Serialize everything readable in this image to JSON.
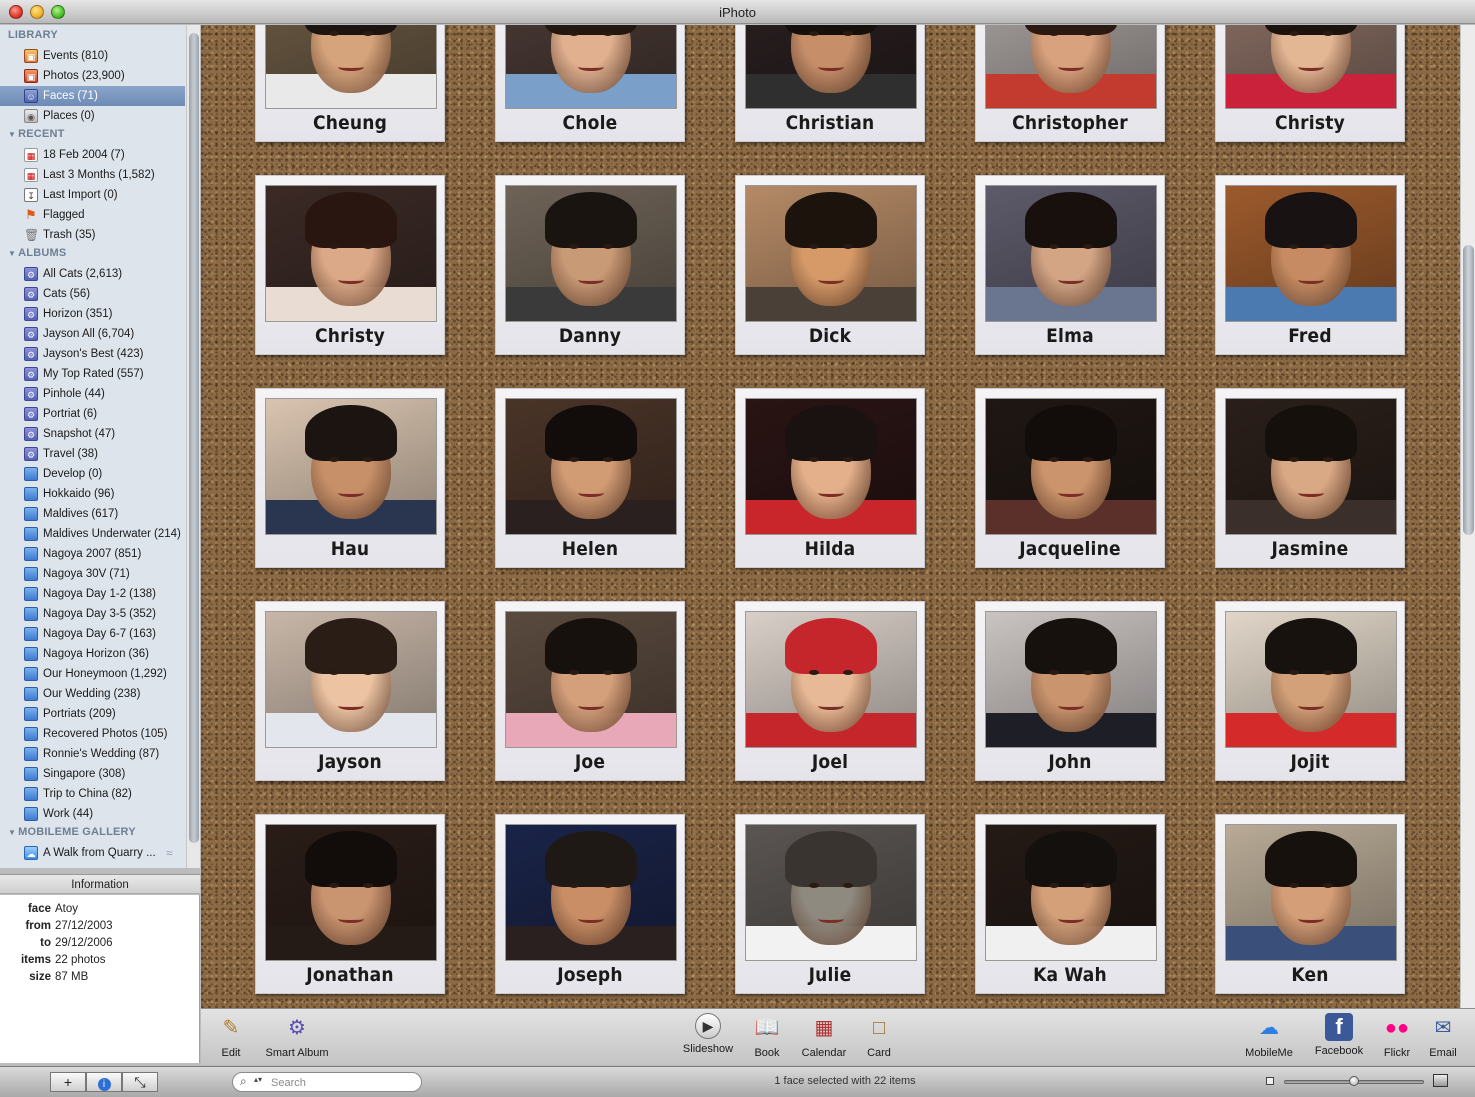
{
  "window": {
    "title": "iPhoto"
  },
  "sidebar": {
    "sections": [
      {
        "key": "library",
        "label": "LIBRARY",
        "collapsible": false
      },
      {
        "key": "recent",
        "label": "RECENT",
        "collapsible": true
      },
      {
        "key": "albums",
        "label": "ALBUMS",
        "collapsible": true
      },
      {
        "key": "mobileme",
        "label": "MOBILEME GALLERY",
        "collapsible": true
      }
    ],
    "items": [
      {
        "section": "library",
        "icon": "events-icon",
        "label": "Events",
        "count": "(810)"
      },
      {
        "section": "library",
        "icon": "photos-icon",
        "label": "Photos",
        "count": "(23,900)"
      },
      {
        "section": "library",
        "icon": "faces-icon",
        "label": "Faces",
        "count": "(71)",
        "selected": true
      },
      {
        "section": "library",
        "icon": "places-icon",
        "label": "Places",
        "count": "(0)"
      },
      {
        "section": "recent",
        "icon": "calendar-icon",
        "label": "18 Feb 2004",
        "count": "(7)"
      },
      {
        "section": "recent",
        "icon": "calendar-icon",
        "label": "Last 3 Months",
        "count": "(1,582)"
      },
      {
        "section": "recent",
        "icon": "import-icon",
        "label": "Last Import",
        "count": "(0)"
      },
      {
        "section": "recent",
        "icon": "flag-icon",
        "label": "Flagged",
        "count": ""
      },
      {
        "section": "recent",
        "icon": "trash-icon",
        "label": "Trash",
        "count": "(35)"
      },
      {
        "section": "albums",
        "icon": "smart-album-icon",
        "label": "All Cats",
        "count": "(2,613)"
      },
      {
        "section": "albums",
        "icon": "smart-album-icon",
        "label": "Cats",
        "count": "(56)"
      },
      {
        "section": "albums",
        "icon": "smart-album-icon",
        "label": "Horizon",
        "count": "(351)"
      },
      {
        "section": "albums",
        "icon": "smart-album-icon",
        "label": "Jayson All",
        "count": "(6,704)"
      },
      {
        "section": "albums",
        "icon": "smart-album-icon",
        "label": "Jayson's Best",
        "count": "(423)"
      },
      {
        "section": "albums",
        "icon": "smart-album-icon",
        "label": "My Top Rated",
        "count": "(557)"
      },
      {
        "section": "albums",
        "icon": "smart-album-icon",
        "label": "Pinhole",
        "count": "(44)"
      },
      {
        "section": "albums",
        "icon": "smart-album-icon",
        "label": "Portriat",
        "count": "(6)"
      },
      {
        "section": "albums",
        "icon": "smart-album-icon",
        "label": "Snapshot",
        "count": "(47)"
      },
      {
        "section": "albums",
        "icon": "smart-album-icon",
        "label": "Travel",
        "count": "(38)"
      },
      {
        "section": "albums",
        "icon": "album-icon",
        "label": "Develop",
        "count": "(0)"
      },
      {
        "section": "albums",
        "icon": "album-icon",
        "label": "Hokkaido",
        "count": "(96)"
      },
      {
        "section": "albums",
        "icon": "album-icon",
        "label": "Maldives",
        "count": "(617)"
      },
      {
        "section": "albums",
        "icon": "album-icon",
        "label": "Maldives Underwater",
        "count": "(214)"
      },
      {
        "section": "albums",
        "icon": "album-icon",
        "label": "Nagoya 2007",
        "count": "(851)"
      },
      {
        "section": "albums",
        "icon": "album-icon",
        "label": "Nagoya 30V",
        "count": "(71)"
      },
      {
        "section": "albums",
        "icon": "album-icon",
        "label": "Nagoya Day 1-2",
        "count": "(138)"
      },
      {
        "section": "albums",
        "icon": "album-icon",
        "label": "Nagoya Day 3-5",
        "count": "(352)"
      },
      {
        "section": "albums",
        "icon": "album-icon",
        "label": "Nagoya Day 6-7",
        "count": "(163)"
      },
      {
        "section": "albums",
        "icon": "album-icon",
        "label": "Nagoya Horizon",
        "count": "(36)"
      },
      {
        "section": "albums",
        "icon": "album-icon",
        "label": "Our Honeymoon",
        "count": "(1,292)"
      },
      {
        "section": "albums",
        "icon": "album-icon",
        "label": "Our Wedding",
        "count": "(238)"
      },
      {
        "section": "albums",
        "icon": "album-icon",
        "label": "Portriats",
        "count": "(209)"
      },
      {
        "section": "albums",
        "icon": "album-icon",
        "label": "Recovered Photos",
        "count": "(105)"
      },
      {
        "section": "albums",
        "icon": "album-icon",
        "label": "Ronnie's Wedding",
        "count": "(87)"
      },
      {
        "section": "albums",
        "icon": "album-icon",
        "label": "Singapore",
        "count": "(308)"
      },
      {
        "section": "albums",
        "icon": "album-icon",
        "label": "Trip to China",
        "count": "(82)"
      },
      {
        "section": "albums",
        "icon": "album-icon",
        "label": "Work",
        "count": "(44)"
      },
      {
        "section": "mobileme",
        "icon": "mobileme-gallery-icon",
        "label": "A Walk from Quarry ...",
        "count": ""
      }
    ]
  },
  "info": {
    "header": "Information",
    "rows": [
      {
        "key": "face",
        "value": "Atoy"
      },
      {
        "key": "from",
        "value": "27/12/2003"
      },
      {
        "key": "to",
        "value": "29/12/2006"
      },
      {
        "key": "items",
        "value": "22 photos"
      },
      {
        "key": "size",
        "value": "87 MB"
      }
    ]
  },
  "faces": [
    {
      "name": "Cheung",
      "bg": "#6b5a44",
      "skin": "#d6a47c",
      "hair": "#1b1411",
      "shirt": "#e9e9e9"
    },
    {
      "name": "Chole",
      "bg": "#4a3a35",
      "skin": "#e0b08f",
      "hair": "#22180f",
      "shirt": "#7a9fc9"
    },
    {
      "name": "Christian",
      "bg": "#2a2020",
      "skin": "#c68f6a",
      "hair": "#16100c",
      "shirt": "#2f2f2f"
    },
    {
      "name": "Christopher",
      "bg": "#a9a2a0",
      "skin": "#d9a27e",
      "hair": "#2a1a12",
      "shirt": "#c33a2f"
    },
    {
      "name": "Christy",
      "bg": "#8a6f64",
      "skin": "#e3b694",
      "hair": "#1c120e",
      "shirt": "#c9223a"
    },
    {
      "name": "Christy",
      "bg": "#3b2a26",
      "skin": "#dca988",
      "hair": "#2a1610",
      "shirt": "#e8dcd3"
    },
    {
      "name": "Danny",
      "bg": "#6e6357",
      "skin": "#c99a76",
      "hair": "#1a1410",
      "shirt": "#3a3a3a"
    },
    {
      "name": "Dick",
      "bg": "#b58a66",
      "skin": "#d69a68",
      "hair": "#1c130d",
      "shirt": "#4b4037"
    },
    {
      "name": "Elma",
      "bg": "#5d5a6a",
      "skin": "#d3a585",
      "hair": "#17100d",
      "shirt": "#6a7590"
    },
    {
      "name": "Fred",
      "bg": "#9c5a2c",
      "skin": "#c68b62",
      "hair": "#181212",
      "shirt": "#4a7ab0"
    },
    {
      "name": "Hau",
      "bg": "#d9c4b0",
      "skin": "#c89069",
      "hair": "#1b1410",
      "shirt": "#2a3550"
    },
    {
      "name": "Helen",
      "bg": "#4a3428",
      "skin": "#d19b74",
      "hair": "#120c0a",
      "shirt": "#2a2020"
    },
    {
      "name": "Hilda",
      "bg": "#2a1414",
      "skin": "#e4b08c",
      "hair": "#1a1210",
      "shirt": "#c8262a"
    },
    {
      "name": "Jacqueline",
      "bg": "#1f1713",
      "skin": "#cc946c",
      "hair": "#120c0a",
      "shirt": "#5b2f2a"
    },
    {
      "name": "Jasmine",
      "bg": "#2a1f1a",
      "skin": "#d9a885",
      "hair": "#16100c",
      "shirt": "#3a2f2a"
    },
    {
      "name": "Jayson",
      "bg": "#c8b7a8",
      "skin": "#ecc4a4",
      "hair": "#2a1d16",
      "shirt": "#e4e6ee"
    },
    {
      "name": "Joe",
      "bg": "#5a4a3e",
      "skin": "#d4a07c",
      "hair": "#17110e",
      "shirt": "#e8a8b8"
    },
    {
      "name": "Joel",
      "bg": "#d9cfc8",
      "skin": "#e8b996",
      "hair": "#c4262c",
      "shirt": "#c4262c"
    },
    {
      "name": "John",
      "bg": "#c9c3c1",
      "skin": "#c9946e",
      "hair": "#17110e",
      "shirt": "#1e1e26"
    },
    {
      "name": "Jojit",
      "bg": "#e1d6c8",
      "skin": "#d2a079",
      "hair": "#18120f",
      "shirt": "#d42a2a"
    },
    {
      "name": "Jonathan",
      "bg": "#2a1d18",
      "skin": "#c99470",
      "hair": "#120c0a",
      "shirt": "#241a16"
    },
    {
      "name": "Joseph",
      "bg": "#1a2448",
      "skin": "#c98e66",
      "hair": "#1f1916",
      "shirt": "#2a2020"
    },
    {
      "name": "Julie",
      "bg": "#5a5552",
      "skin": "#8f8a80",
      "hair": "#3a3430",
      "shirt": "#f2f2f2"
    },
    {
      "name": "Ka Wah",
      "bg": "#241a16",
      "skin": "#d4a07a",
      "hair": "#14100d",
      "shirt": "#f0f0f0"
    },
    {
      "name": "Ken",
      "bg": "#b8aa96",
      "skin": "#d49e78",
      "hair": "#17110e",
      "shirt": "#3a4f7a"
    }
  ],
  "toolbar": {
    "left": [
      {
        "label": "Edit",
        "icon": "pencil-icon"
      },
      {
        "label": "Smart Album",
        "icon": "smart-album-icon"
      }
    ],
    "center": [
      {
        "label": "Slideshow",
        "icon": "play-icon"
      },
      {
        "label": "Book",
        "icon": "book-icon"
      },
      {
        "label": "Calendar",
        "icon": "calendar-icon"
      },
      {
        "label": "Card",
        "icon": "card-icon"
      }
    ],
    "right": [
      {
        "label": "MobileMe",
        "icon": "mobileme-icon"
      },
      {
        "label": "Facebook",
        "icon": "facebook-icon"
      },
      {
        "label": "Flickr",
        "icon": "flickr-icon"
      },
      {
        "label": "Email",
        "icon": "email-icon"
      }
    ]
  },
  "statusbar": {
    "search_placeholder": "Search",
    "status_text": "1 face selected with 22 items",
    "zoom_level": 0.5
  }
}
